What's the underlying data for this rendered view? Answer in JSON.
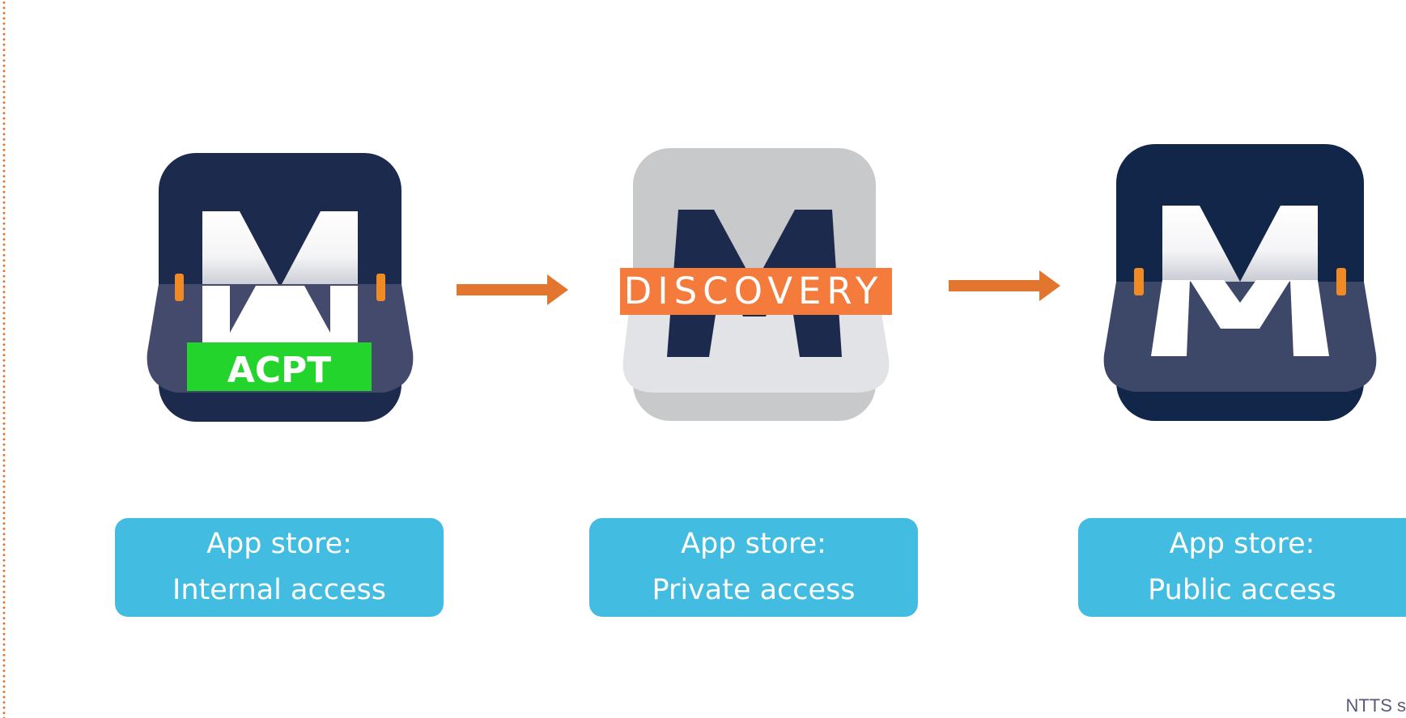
{
  "diagram": {
    "stages": [
      {
        "id": "internal",
        "badge_text": "ACPT",
        "badge_color": "#22d42c",
        "icon_theme": "dark",
        "label_line1": "App store:",
        "label_line2": "Internal access"
      },
      {
        "id": "private",
        "badge_text": "DISCOVERY",
        "badge_color": "#f47b3b",
        "icon_theme": "grey",
        "label_line1": "App store:",
        "label_line2": "Private access"
      },
      {
        "id": "public",
        "badge_text": "",
        "icon_theme": "navy",
        "label_line1": "App store:",
        "label_line2": "Public access"
      }
    ],
    "arrow_color": "#e2762f",
    "label_color": "#43bce2"
  },
  "footer": {
    "text": "NTTS s"
  },
  "colors": {
    "navy": "#1c2b4d",
    "orange": "#e2762f",
    "green": "#22d42c",
    "grey": "#c8c9cb"
  }
}
